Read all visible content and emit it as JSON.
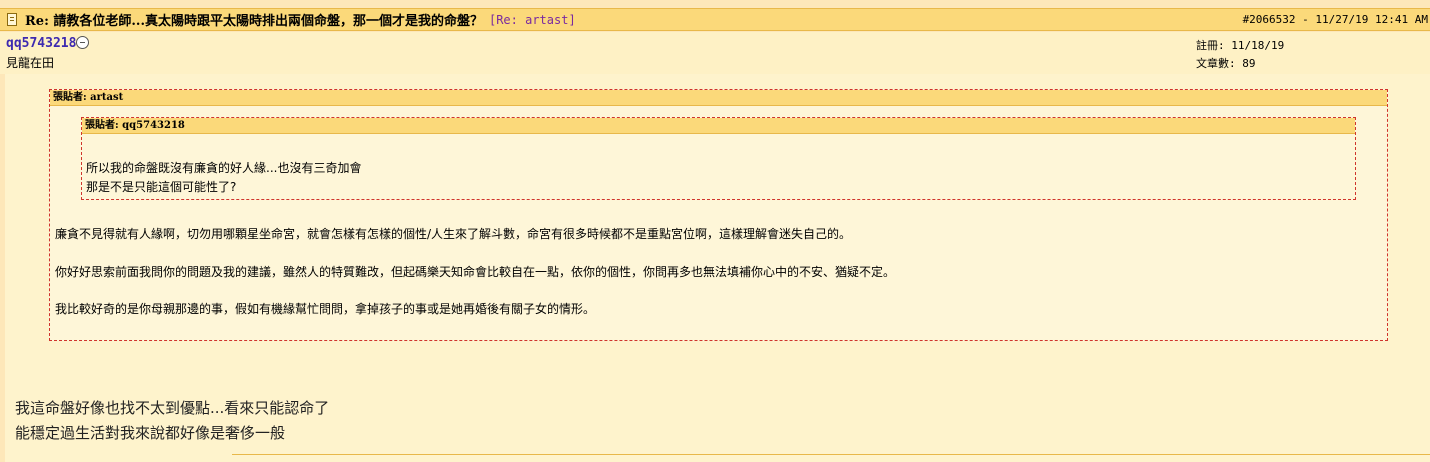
{
  "post": {
    "title": "Re: 請教各位老師...真太陽時跟平太陽時排出兩個命盤，那一個才是我的命盤？",
    "reply_ref": "[Re: artast]",
    "meta": "#2066532 - 11/27/19 12:41 AM"
  },
  "author": {
    "username": "qq5743218",
    "title": "見龍在田",
    "registered": "註冊: 11/18/19",
    "post_count": "文章數: 89"
  },
  "quote_outer": {
    "header": "張貼者: artast",
    "paragraphs": [
      "廉貪不見得就有人緣啊，切勿用哪顆星坐命宮，就會怎樣有怎樣的個性/人生來了解斗數，命宮有很多時候都不是重點宮位啊，這樣理解會迷失自己的。",
      "你好好思索前面我問你的問題及我的建議，雖然人的特質難改，但起碼樂天知命會比較自在一點，依你的個性，你問再多也無法填補你心中的不安、猶疑不定。",
      "我比較好奇的是你母親那邊的事，假如有機緣幫忙問問，拿掉孩子的事或是她再婚後有關子女的情形。"
    ]
  },
  "quote_inner": {
    "header": "張貼者: qq5743218",
    "lines": [
      "所以我的命盤既沒有廉貪的好人緣...也沒有三奇加會",
      "那是不是只能這個可能性了?"
    ]
  },
  "reply": {
    "lines": [
      "我這命盤好像也找不太到優點...看來只能認命了",
      "能穩定過生活對我來說都好像是奢侈一般"
    ]
  },
  "colors": {
    "header_bg": "#fbd97a",
    "body_bg": "#fef3cc",
    "quote_border": "#d0342c",
    "username": "#3d2ab0"
  }
}
